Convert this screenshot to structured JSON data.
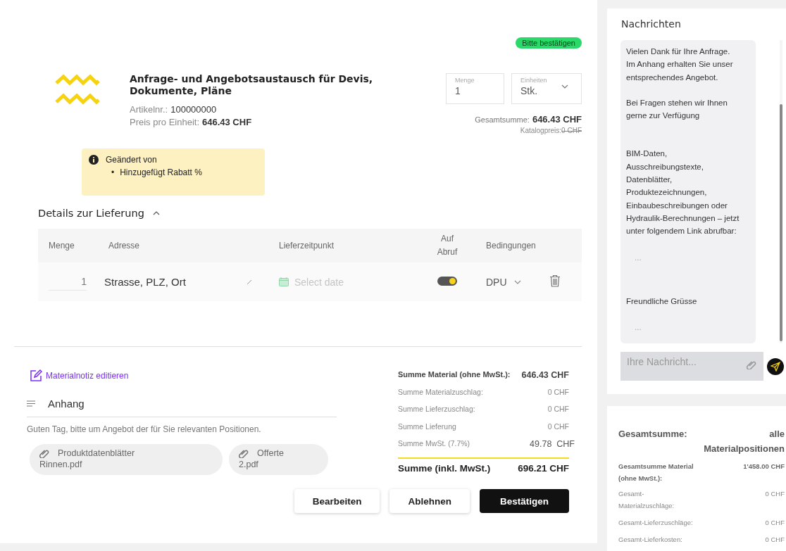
{
  "status_badge": "Bitte bestätigen",
  "product": {
    "title": "Anfrage- und Angebotsaustausch für Devis, Dokumente, Pläne",
    "article_label": "Artikelnr.:",
    "article_number": "100000000",
    "unit_price_label": "Preis pro Einheit:",
    "unit_price": "646.43 CHF"
  },
  "quantity_field": {
    "label": "Menge",
    "value": "1"
  },
  "unit_select": {
    "label": "Einheiten",
    "value": "Stk."
  },
  "total": {
    "label": "Gesamtsumme:",
    "value": "646.43 CHF"
  },
  "catalog_price": {
    "label": "Katalogpreis:",
    "value": "0 CHF"
  },
  "change_note": {
    "title": "Geändert von",
    "items": [
      {
        "marker": "•",
        "text": "Hinzugefügt Rabatt %"
      }
    ]
  },
  "delivery": {
    "title": "Details zur Lieferung",
    "expanded": true,
    "columns": [
      "Menge",
      "Adresse",
      "Lieferzeitpunkt",
      "Auf Abruf",
      "Bedingungen"
    ],
    "rows": [
      {
        "quantity": "1",
        "address": "Strasse, PLZ, Ort",
        "date_placeholder": "Select date",
        "on_call": true,
        "terms": "DPU"
      }
    ]
  },
  "material_note_link": "Materialnotiz editieren",
  "attachments": {
    "title": "Anhang",
    "message": "Guten Tag, bitte um Angebot der für Sie relevanten Positionen.",
    "files": [
      {
        "name": "Produktdatenblätter",
        "file": "Rinnen.pdf"
      },
      {
        "name": "Offerte",
        "file": "2.pdf"
      }
    ]
  },
  "summary": {
    "rows": [
      {
        "label": "Summe Material (ohne MwSt.):",
        "value": "646.43 CHF",
        "kind": "strong"
      },
      {
        "label": "Summe Materialzuschlag:",
        "value": "0 CHF",
        "kind": "plain"
      },
      {
        "label": "Summe Lieferzuschlag:",
        "value": "0 CHF",
        "kind": "plain"
      },
      {
        "label": "Summe Lieferung",
        "value": "0 CHF",
        "kind": "plain"
      },
      {
        "label": "Summe MwSt. (7.7%)",
        "value": "49.78  CHF",
        "kind": "tax"
      }
    ],
    "total": {
      "label": "Summe (inkl. MwSt.)",
      "value": "696.21 CHF"
    }
  },
  "buttons": [
    {
      "label": "Bearbeiten",
      "kind": "secondary"
    },
    {
      "label": "Ablehnen",
      "kind": "secondary"
    },
    {
      "label": "Bestätigen",
      "kind": "primary"
    }
  ],
  "messages": {
    "title": "Nachrichten",
    "paragraphs": [
      {
        "kind": "text",
        "text": "Vielen Dank für Ihre Anfrage.\nIm Anhang erhalten Sie unser entsprechendes Angebot."
      },
      {
        "kind": "text",
        "text": "Bei Fragen stehen wir Ihnen gerne zur Verfügung"
      },
      {
        "kind": "text",
        "text": "BIM-Daten,\nAusschreibungstexte,\nDatenblätter,\nProduktezeichnungen,\nEinbaubeschreibungen oder Hydraulik-Berechnungen – jetzt unter folgendem Link abrufbar:"
      },
      {
        "kind": "ellipsis",
        "text": "..."
      },
      {
        "kind": "text",
        "text": "Freundliche Grüsse"
      },
      {
        "kind": "ellipsis",
        "text": "..."
      }
    ],
    "input": {
      "placeholder": "Ihre Nachricht..."
    }
  },
  "grand_totals": {
    "label": "Gesamtsumme:",
    "scope": "alle Materialpositionen",
    "rows": [
      {
        "label": "Gesamtsumme Material (ohne MwSt.):",
        "value": "1'458.00 CHF",
        "kind": "strong"
      },
      {
        "label": "Gesamt-Materialzuschläge:",
        "value": "0 CHF",
        "kind": "plain"
      },
      {
        "label": "Gesamt-Lieferzuschläge:",
        "value": "0 CHF",
        "kind": "plain"
      },
      {
        "label": "Gesamt-Lieferkosten:",
        "value": "0 CHF",
        "kind": "plain"
      }
    ]
  }
}
